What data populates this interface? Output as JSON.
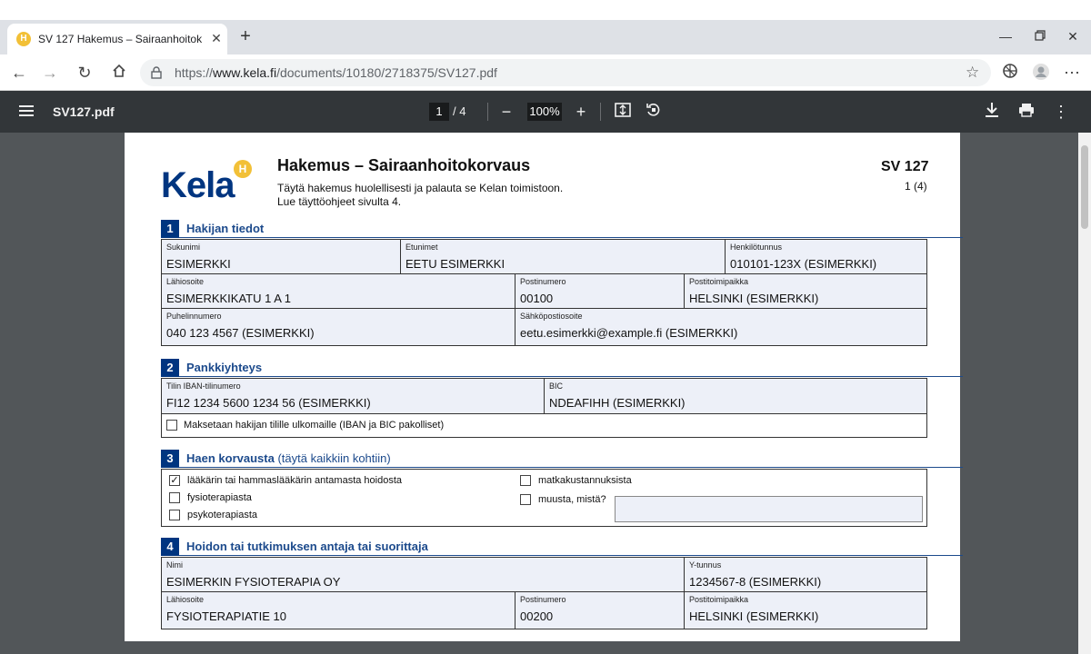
{
  "browser": {
    "tab_title": "SV 127 Hakemus – Sairaanhoitokorvaus",
    "favicon_letter": "H",
    "url_prefix": "https://",
    "url_host": "www.kela.fi",
    "url_path": "/documents/10180/2718375/SV127.pdf"
  },
  "pdf_viewer": {
    "file_name": "SV127.pdf",
    "current_page": "1",
    "page_total": "/  4",
    "zoom": "100%"
  },
  "form": {
    "logo_text": "Kela",
    "logo_mark": "H",
    "title": "Hakemus – Sairaanhoitokorvaus",
    "instruction_line1": "Täytä hakemus huolellisesti ja palauta se Kelan toimistoon.",
    "instruction_line2": "Lue täyttöohjeet sivulta 4.",
    "code": "SV 127",
    "page_indicator": "1 (4)",
    "sections": [
      {
        "number": "1",
        "title": "Hakijan tiedot",
        "fields": {
          "surname": {
            "label": "Sukunimi",
            "value": "ESIMERKKI"
          },
          "first_names": {
            "label": "Etunimet",
            "value": "EETU ESIMERKKI"
          },
          "personal_id": {
            "label": "Henkilötunnus",
            "value": "010101-123X (ESIMERKKI)"
          },
          "street": {
            "label": "Lähiosoite",
            "value": "ESIMERKKIKATU 1 A 1"
          },
          "postcode": {
            "label": "Postinumero",
            "value": "00100"
          },
          "post_office": {
            "label": "Postitoimipaikka",
            "value": "HELSINKI (ESIMERKKI)"
          },
          "phone": {
            "label": "Puhelinnumero",
            "value": "040 123 4567 (ESIMERKKI)"
          },
          "email": {
            "label": "Sähköpostiosoite",
            "value": "eetu.esimerkki@example.fi (ESIMERKKI)"
          }
        }
      },
      {
        "number": "2",
        "title": "Pankkiyhteys",
        "fields": {
          "iban": {
            "label": "Tilin IBAN-tilinumero",
            "value": "FI12 1234 5600 1234 56 (ESIMERKKI)"
          },
          "bic": {
            "label": "BIC",
            "value": "NDEAFIHH (ESIMERKKI)"
          },
          "foreign_account": {
            "label": "Maksetaan hakijan tilille ulkomaille (IBAN ja BIC pakolliset)",
            "checked": false
          }
        }
      },
      {
        "number": "3",
        "title": "Haen korvausta",
        "subtitle": "(täytä kaikkiin kohtiin)",
        "options": [
          {
            "label": "lääkärin tai hammaslääkärin antamasta hoidosta",
            "checked": true,
            "mark": "✓"
          },
          {
            "label": "fysioterapiasta",
            "checked": false
          },
          {
            "label": "psykoterapiasta",
            "checked": false
          },
          {
            "label": "matkakustannuksista",
            "checked": false
          },
          {
            "label": "muusta, mistä?",
            "checked": false
          }
        ],
        "other_value": ""
      },
      {
        "number": "4",
        "title": "Hoidon tai tutkimuksen antaja tai suorittaja",
        "fields": {
          "name": {
            "label": "Nimi",
            "value": "ESIMERKIN FYSIOTERAPIA OY"
          },
          "business_id": {
            "label": "Y-tunnus",
            "value": "1234567-8 (ESIMERKKI)"
          },
          "street": {
            "label": "Lähiosoite",
            "value": "FYSIOTERAPIATIE 10"
          },
          "postcode": {
            "label": "Postinumero",
            "value": "00200"
          },
          "post_office": {
            "label": "Postitoimipaikka",
            "value": "HELSINKI (ESIMERKKI)"
          }
        }
      }
    ]
  },
  "colors": {
    "kela_blue": "#003580",
    "section_title_blue": "#1c4a8c",
    "field_fill": "#edf0f8",
    "pdf_toolbar": "#323639",
    "pdf_background": "#525659",
    "kela_yellow": "#f2c037"
  }
}
